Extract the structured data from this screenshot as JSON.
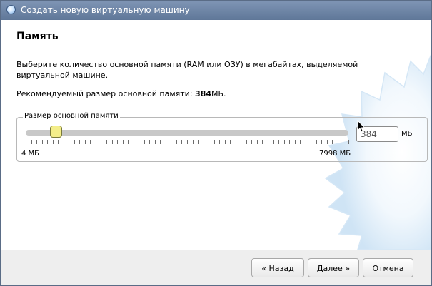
{
  "window": {
    "title": "Создать новую виртуальную машину"
  },
  "page": {
    "heading": "Память",
    "description": "Выберите количество основной памяти (RAM или ОЗУ) в мегабайтах, выделяемой виртуальной машине.",
    "recommended_prefix": "Рекомендуемый размер основной памяти: ",
    "recommended_value": "384",
    "recommended_suffix": "МБ."
  },
  "memory": {
    "group_label": "Размер основной памяти",
    "min_label": "4 МБ",
    "max_label": "7998 МБ",
    "min": 4,
    "max": 7998,
    "value": "384",
    "unit": "МБ"
  },
  "buttons": {
    "back": "« Назад",
    "next": "Далее »",
    "cancel": "Отмена"
  },
  "colors": {
    "titlebar": "#6d84a6",
    "slider_thumb": "#f4ee8a",
    "watermark": "#cfe4f5"
  }
}
